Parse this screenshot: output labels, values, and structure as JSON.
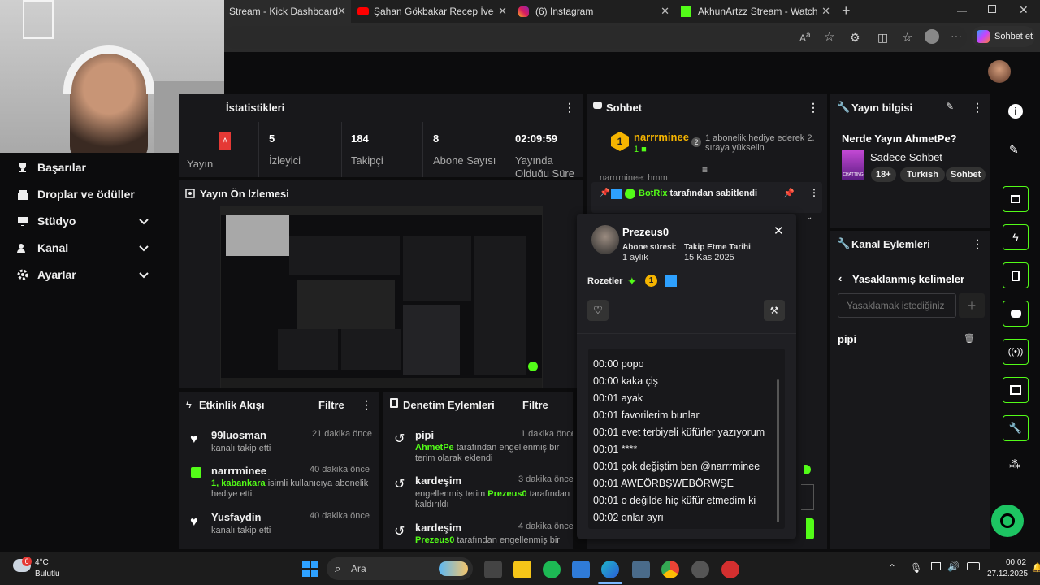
{
  "browser": {
    "tabs": [
      {
        "label": "Stream - Kick Dashboard"
      },
      {
        "label": "Şahan Gökbakar Recep İvedik Sah"
      },
      {
        "label": "(6) Instagram"
      },
      {
        "label": "AkhunArtzz Stream - Watch Live o"
      }
    ],
    "copilot_label": "Sohbet et"
  },
  "sidebar": {
    "items": [
      {
        "label": "Başarılar"
      },
      {
        "label": "Droplar ve ödüller"
      },
      {
        "label": "Stüdyo"
      },
      {
        "label": "Kanal"
      },
      {
        "label": "Ayarlar"
      }
    ]
  },
  "stats": {
    "title": "İstatistikleri",
    "items": [
      {
        "value": "",
        "label": "Yayın"
      },
      {
        "value": "5",
        "label": "İzleyici"
      },
      {
        "value": "184",
        "label": "Takipçi"
      },
      {
        "value": "8",
        "label": "Abone Sayısı"
      },
      {
        "value": "02:09:59",
        "label": "Yayında Olduğu Süre"
      }
    ]
  },
  "preview": {
    "title": "Yayın Ön İzlemesi"
  },
  "activity": {
    "title": "Etkinlik Akışı",
    "filter": "Filtre",
    "items": [
      {
        "name": "99luosman",
        "time": "21 dakika önce",
        "text": "kanalı takip etti"
      },
      {
        "name": "narrrminee",
        "time": "40 dakika önce",
        "highlight": "1, kabankara",
        "text": " isimli kullanıcıya abonelik hediye etti."
      },
      {
        "name": "Yusfaydin",
        "time": "40 dakika önce",
        "text": "kanalı takip etti"
      }
    ]
  },
  "moderation": {
    "title": "Denetim Eylemleri",
    "filter": "Filtre",
    "items": [
      {
        "term": "pipi",
        "time": "1 dakika önce",
        "actor": "AhmetPe",
        "text": " tarafından engellenmiş bir terim olarak eklendi"
      },
      {
        "term": "kardeşim",
        "time": "3 dakika önce",
        "pre": "engellenmiş terim ",
        "actor": "Prezeus0",
        "text": " tarafından kaldırıldı"
      },
      {
        "term": "kardeşim",
        "time": "4 dakika önce",
        "actor": "Prezeus0",
        "text": " tarafından engellenmiş bir"
      }
    ]
  },
  "chat": {
    "title": "Sohbet",
    "gift_user": "narrrminee",
    "gift_count": "1",
    "gift_text": "1 abonelik hediye ederek 2. sıraya yükselin",
    "gift_rank": "2",
    "partial_user": "narrrminee: hmm",
    "pinned_by": "BotRix",
    "pinned_text": " tarafından sabitlendi"
  },
  "user_card": {
    "username": "Prezeus0",
    "sub_label": "Abone süresi:",
    "sub_value": "1 aylık",
    "follow_label": "Takip Etme Tarihi",
    "follow_value": "15 Kas 2025",
    "badges_label": "Rozetler",
    "badge_count": "1",
    "log": [
      "00:00 popo",
      "00:00 kaka çiş",
      "00:01 ayak",
      "00:01 favorilerim bunlar",
      "00:01 evet terbiyeli küfürler yazıyorum",
      "00:01 ****",
      "00:01 çok değiştim ben @narrrminee",
      "00:01 AWEÖRBŞWEBÖRWŞE",
      "00:01 o değilde hiç küfür etmedim ki",
      "00:02 onlar ayrı"
    ]
  },
  "stream_info": {
    "title": "Yayın bilgisi",
    "stream_title": "Nerde Yayın AhmetPe?",
    "category": "Sadece Sohbet",
    "tags": [
      "18+",
      "Turkish",
      "Sohbet"
    ],
    "thumb_text": "CHATTING"
  },
  "channel_actions": {
    "title": "Kanal Eylemleri",
    "back_label": "Yasaklanmış kelimeler",
    "input_placeholder": "Yasaklamak istediğiniz",
    "add_label": "+",
    "words": [
      "pipi"
    ]
  },
  "taskbar": {
    "weather_temp": "4°C",
    "weather_text": "Bulutlu",
    "weather_badge": "6",
    "search_label": "Ara",
    "time": "00:02",
    "date": "27.12.2025"
  },
  "colors": {
    "accent": "#53fc18",
    "panel": "#18181b",
    "bg": "#0c0c0d"
  }
}
